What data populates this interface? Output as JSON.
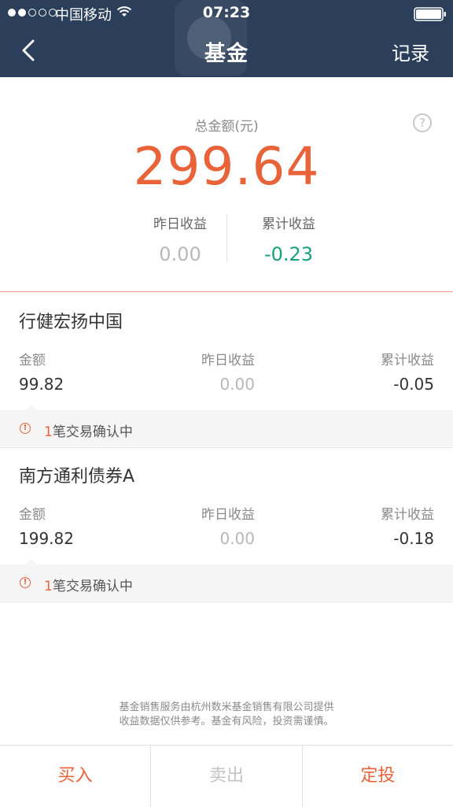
{
  "status_bar": {
    "carrier": "中国移动",
    "time": "07:23",
    "signal_bars_filled": 2,
    "signal_bars_total": 5
  },
  "nav": {
    "title": "基金",
    "right_action": "记录",
    "back_icon": "chevron-left-icon"
  },
  "summary": {
    "total_label": "总金额(元)",
    "total_value": "299.64",
    "help_icon": "?",
    "yesterday_label": "昨日收益",
    "yesterday_value": "0.00",
    "cumulative_label": "累计收益",
    "cumulative_value": "-0.23"
  },
  "funds": [
    {
      "name": "行健宏扬中国",
      "amount_label": "金额",
      "amount": "99.82",
      "yesterday_label": "昨日收益",
      "yesterday": "0.00",
      "cumulative_label": "累计收益",
      "cumulative": "-0.05",
      "pending_count": "1",
      "pending_text": "笔交易确认中"
    },
    {
      "name": "南方通利债券A",
      "amount_label": "金额",
      "amount": "199.82",
      "yesterday_label": "昨日收益",
      "yesterday": "0.00",
      "cumulative_label": "累计收益",
      "cumulative": "-0.18",
      "pending_count": "1",
      "pending_text": "笔交易确认中"
    }
  ],
  "disclaimer": {
    "line1": "基金销售服务由杭州数米基金销售有限公司提供",
    "line2": "收益数据仅供参考。基金有风险，投资需谨慎。"
  },
  "bottom_bar": {
    "buy": "买入",
    "sell": "卖出",
    "fixed_invest": "定投"
  },
  "colors": {
    "header_bg": "#2b3e5a",
    "accent": "#e8623a",
    "positive_green": "#1aa07a",
    "muted": "#b8b8b8"
  }
}
